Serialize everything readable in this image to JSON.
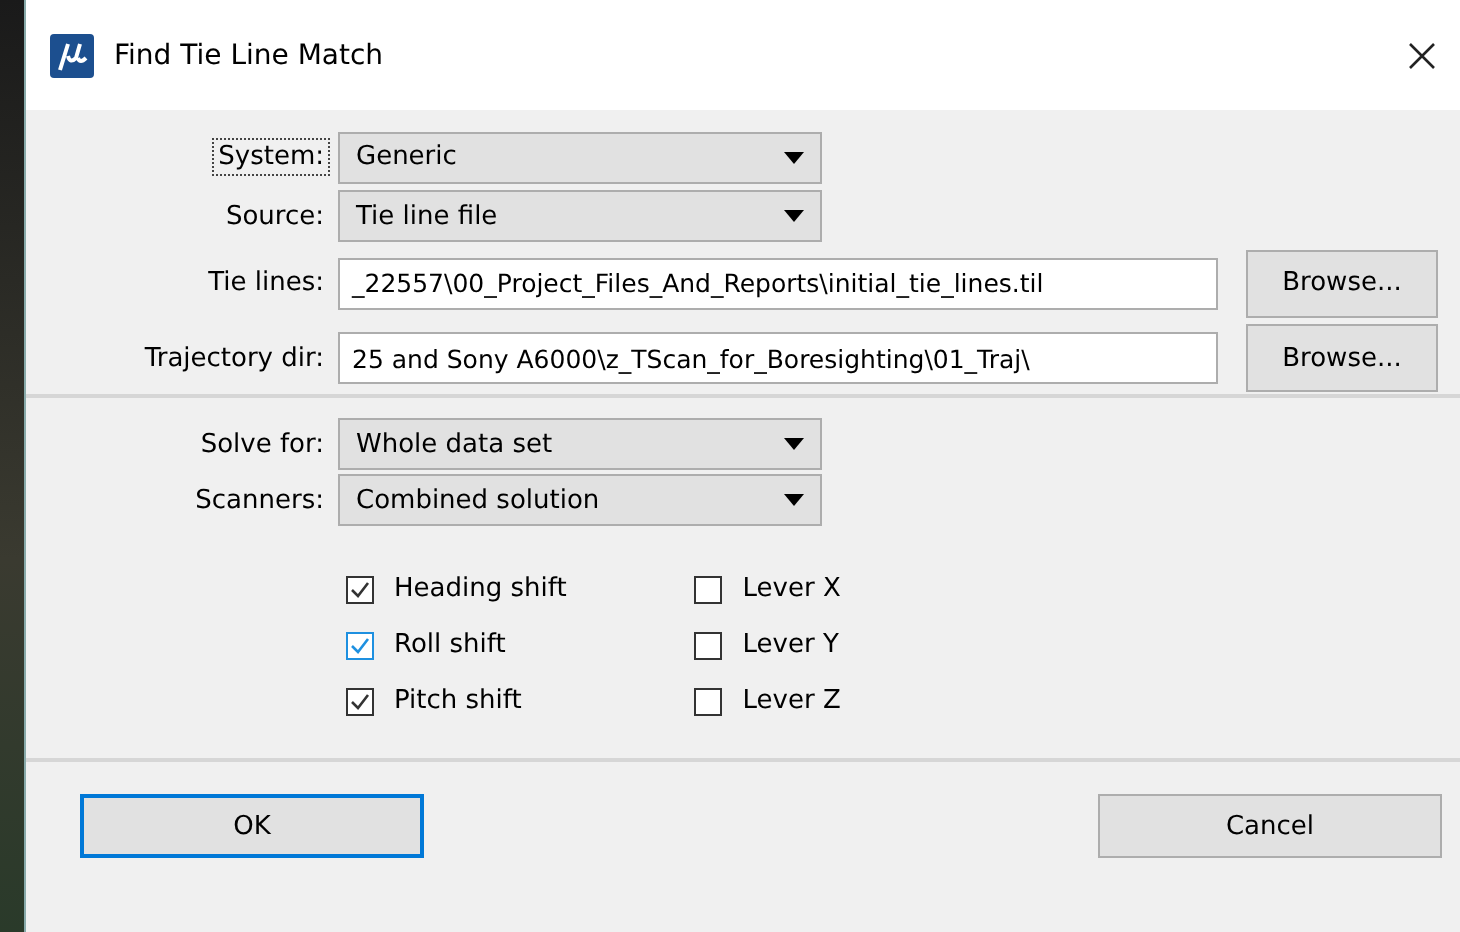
{
  "window": {
    "title": "Find Tie Line Match"
  },
  "source_fields": [
    {
      "kind": "dropdown",
      "label": "System:",
      "value": "Generic",
      "focused": true
    },
    {
      "kind": "dropdown",
      "label": "Source:",
      "value": "Tie line file",
      "focused": false
    },
    {
      "kind": "path",
      "label": "Tie lines:",
      "value": "_22557\\00_Project_Files_And_Reports\\initial_tie_lines.til",
      "button": "Browse...",
      "focused": false
    },
    {
      "kind": "path",
      "label": "Trajectory dir:",
      "value": "25 and Sony A6000\\z_TScan_for_Boresighting\\01_Traj\\",
      "button": "Browse...",
      "focused": false
    }
  ],
  "solve_fields": [
    {
      "kind": "dropdown",
      "label": "Solve for:",
      "value": "Whole data set",
      "focused": false
    },
    {
      "kind": "dropdown",
      "label": "Scanners:",
      "value": "Combined solution",
      "focused": false
    }
  ],
  "options_left": [
    {
      "label": "Heading shift",
      "checked": true,
      "hovered": false
    },
    {
      "label": "Roll shift",
      "checked": true,
      "hovered": true
    },
    {
      "label": "Pitch shift",
      "checked": true,
      "hovered": false
    }
  ],
  "options_right": [
    {
      "label": "Lever X",
      "checked": false,
      "hovered": false
    },
    {
      "label": "Lever Y",
      "checked": false,
      "hovered": false
    },
    {
      "label": "Lever Z",
      "checked": false,
      "hovered": false
    }
  ],
  "buttons": [
    {
      "label": "OK",
      "default": true
    },
    {
      "label": "Cancel",
      "default": false
    }
  ]
}
